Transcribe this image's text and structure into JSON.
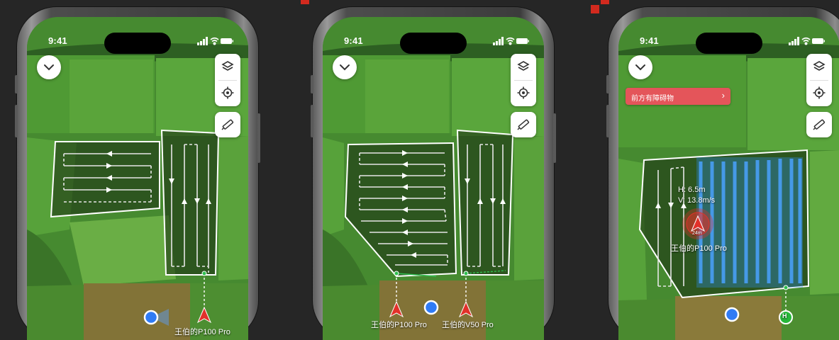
{
  "status_bar": {
    "time": "9:41"
  },
  "phones": [
    {
      "drone_label": "王伯的P100 Pro"
    },
    {
      "drone_labels": [
        "王伯的P100 Pro",
        "王伯的V50 Pro"
      ]
    },
    {
      "alert": {
        "text": "前方有障碍物",
        "chevron": "›"
      },
      "telemetry": {
        "height": "H: 6.5m",
        "velocity": "V: 13.8m/s"
      },
      "drone_label": "王伯的P100 Pro",
      "drone_tag": "24m",
      "home_marker": "H"
    }
  ],
  "icons": [
    "chevron-down-icon",
    "layers-icon",
    "locate-icon",
    "ruler-icon",
    "signal-icon",
    "wifi-icon",
    "battery-icon",
    "drone-arrow-icon",
    "user-location-icon",
    "home-point-icon"
  ],
  "colors": {
    "field_green": "#3f7d2c",
    "route_white": "#ffffff",
    "drone_red": "#e2312a",
    "location_blue": "#2f7bf5",
    "sprayed_blue": "#2f8ef5",
    "alert_red": "#e4555a",
    "home_green": "#27b83a"
  }
}
